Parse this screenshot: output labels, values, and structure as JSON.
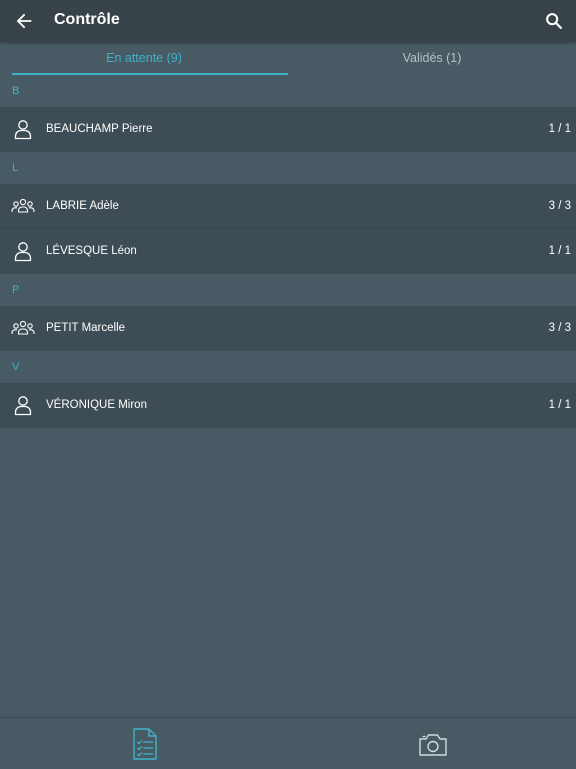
{
  "header": {
    "title": "Contrôle",
    "back_icon": "arrow-left-icon",
    "search_icon": "search-icon"
  },
  "tabs": [
    {
      "label": "En attente (9)",
      "active": true
    },
    {
      "label": "Validés (1)",
      "active": false
    }
  ],
  "sections": [
    {
      "letter": "B",
      "rows": [
        {
          "name": "BEAUCHAMP Pierre",
          "count": "1 / 1",
          "icon": "person-icon"
        }
      ]
    },
    {
      "letter": "L",
      "rows": [
        {
          "name": "LABRIE Adèle",
          "count": "3 / 3",
          "icon": "group-icon"
        },
        {
          "name": "LÉVESQUE Léon",
          "count": "1 / 1",
          "icon": "person-icon"
        }
      ]
    },
    {
      "letter": "P",
      "rows": [
        {
          "name": "PETIT Marcelle",
          "count": "3 / 3",
          "icon": "group-icon"
        }
      ]
    },
    {
      "letter": "V",
      "rows": [
        {
          "name": "VÉRONIQUE Miron",
          "count": "1 / 1",
          "icon": "person-icon"
        }
      ]
    }
  ],
  "bottom_bar": {
    "items": [
      {
        "icon": "checklist-icon",
        "active": true
      },
      {
        "icon": "camera-icon",
        "active": false
      }
    ]
  },
  "colors": {
    "accent": "#3fb2c9",
    "background": "#485a63",
    "toolbar": "#384349",
    "row": "#3e4d55"
  }
}
